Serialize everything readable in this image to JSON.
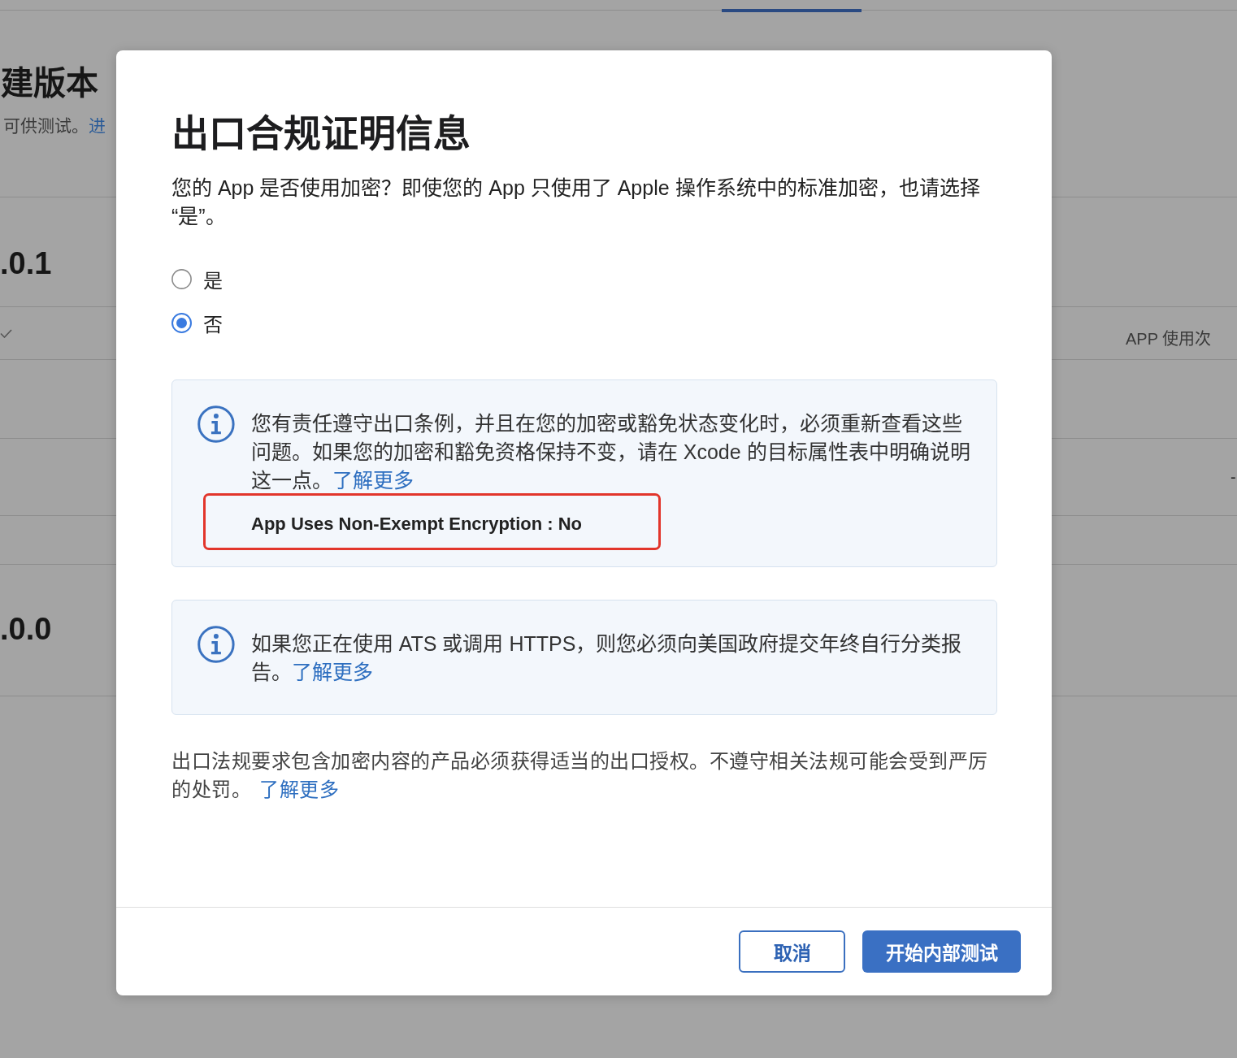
{
  "background_page": {
    "heading": "建版本",
    "subtitle": "可供测试。",
    "subtitle_link": "进",
    "builds": [
      {
        "version": ".0.1",
        "lines": [
          {
            "kind": "header",
            "text": "APP 使用次"
          },
          {
            "kind": "row"
          },
          {
            "kind": "row",
            "text": "-"
          },
          {
            "kind": "spacer"
          }
        ]
      },
      {
        "version": ".0.0"
      }
    ]
  },
  "dialog": {
    "title": "出口合规证明信息",
    "question": "您的 App 是否使用加密？即使您的 App 只使用了 Apple 操作系统中的标准加密，也请选择“是”。",
    "options": [
      {
        "label": "是",
        "selected": false
      },
      {
        "label": "否",
        "selected": true
      }
    ],
    "notices": [
      {
        "text": "您有责任遵守出口条例，并且在您的加密或豁免状态变化时，必须重新查看这些问题。如果您的加密和豁免资格保持不变，请在 Xcode 的目标属性表中明确说明这一点。",
        "link": "了解更多",
        "setting": {
          "text": "App Uses Non-Exempt Encryption : No",
          "highlighted": true
        }
      },
      {
        "text": "如果您正在使用 ATS 或调用 HTTPS，则您必须向美国政府提交年终自行分类报告。",
        "link": "了解更多"
      }
    ],
    "footnote": {
      "text": "出口法规要求包含加密内容的产品必须获得适当的出口授权。不遵守相关法规可能会受到严厉的处罚。",
      "link": "了解更多"
    },
    "buttons": [
      {
        "label": "取消",
        "kind": "secondary"
      },
      {
        "label": "开始内部测试",
        "kind": "primary"
      }
    ]
  }
}
